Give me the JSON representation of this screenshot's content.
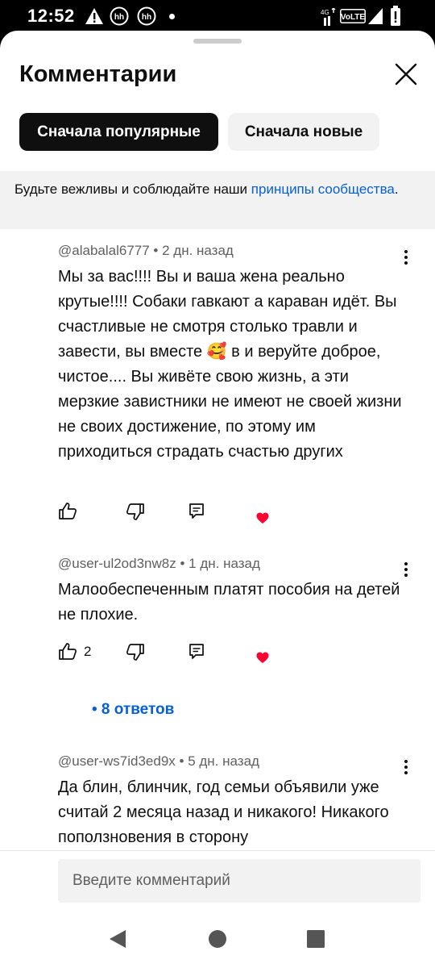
{
  "status_bar": {
    "time": "12:52",
    "icons": [
      "warning-icon",
      "hh-icon",
      "hh-icon",
      "dot-icon",
      "signal-4g-icon",
      "volte-icon",
      "signal-icon",
      "battery-icon"
    ],
    "network_label": "4G",
    "volte_label": "VoLTE",
    "hh_label": "hh"
  },
  "sheet": {
    "title": "Комментарии"
  },
  "sort_chips": [
    {
      "label": "Сначала популярные",
      "active": true
    },
    {
      "label": "Сначала новые",
      "active": false
    }
  ],
  "notice": {
    "text": "Будьте вежливы и соблюдайте наши ",
    "link": "принципы сообщества",
    "end": "."
  },
  "comments": [
    {
      "author": "@alabalal6777",
      "time": "2 дн. назад",
      "text": "Мы за вас!!!! Вы и ваша жена реально крутые!!!! Собаки гавкают а караван идёт. Вы счастливые не смотря столько травли и завести, вы вместе 🥰 в и веруйте доброе, чистое.... Вы живёте свою жизнь, а эти мерзкие завистники не имеют не своей жизни не своих достижение, по этому им приходиться страдать счастью других",
      "likes": ""
    },
    {
      "author": "@user-ul2od3nw8z",
      "time": "1 дн. назад",
      "text": "Малообеспеченным платят пособия на детей не плохие.",
      "likes": "2",
      "replies": "• 8 ответов"
    },
    {
      "author": "@user-ws7id3ed9x",
      "time": "5 дн. назад",
      "text": "Да блин, блинчик, год семьи объявили уже считай 2 месяца назад и никакого! Никакого поползновения в сторону"
    }
  ],
  "meta_separator": " • ",
  "composer": {
    "placeholder": "Введите комментарий"
  },
  "colors": {
    "link": "#065fd4",
    "heart": "#ff0033",
    "chip_active_bg": "#0f0f0f",
    "chip_inactive_bg": "#f2f2f2"
  }
}
